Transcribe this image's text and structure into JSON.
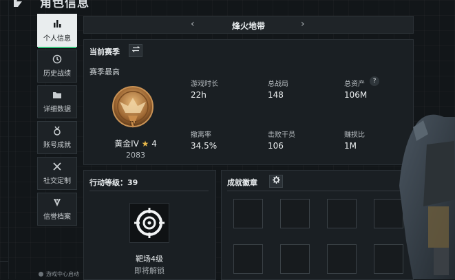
{
  "header": {
    "title": "角色信息"
  },
  "sidebar": {
    "items": [
      {
        "label": "个人信息",
        "icon": "bar-chart-icon",
        "active": true
      },
      {
        "label": "历史战绩",
        "icon": "history-icon"
      },
      {
        "label": "详细数据",
        "icon": "folder-icon"
      },
      {
        "label": "账号成就",
        "icon": "medal-icon"
      },
      {
        "label": "社交定制",
        "icon": "wrench-icon"
      },
      {
        "label": "信誉档案",
        "icon": "shield-icon"
      }
    ],
    "footer": "游戏中心启动"
  },
  "season_bar": {
    "name": "烽火地带",
    "prev": "‹",
    "next": "›"
  },
  "current_season": {
    "title": "当前赛季",
    "season_high": "赛季最高",
    "rank": {
      "name": "黄金IV",
      "star": "★",
      "stars": "4",
      "score": "2083"
    },
    "stats": [
      {
        "label": "游戏时长",
        "value": "22h"
      },
      {
        "label": "总战局",
        "value": "148"
      },
      {
        "label": "总资产",
        "value": "106M"
      },
      {
        "label": "撤离率",
        "value": "34.5%"
      },
      {
        "label": "击败干员",
        "value": "106"
      },
      {
        "label": "赚损比",
        "value": "1M"
      }
    ],
    "help": "?"
  },
  "action_level": {
    "title": "行动等级：39",
    "target_name": "靶场4级",
    "target_status": "即将解锁"
  },
  "achievements": {
    "title": "成就徽章"
  },
  "colors": {
    "accent": "#36c37a",
    "gold": "#e8b84a"
  }
}
